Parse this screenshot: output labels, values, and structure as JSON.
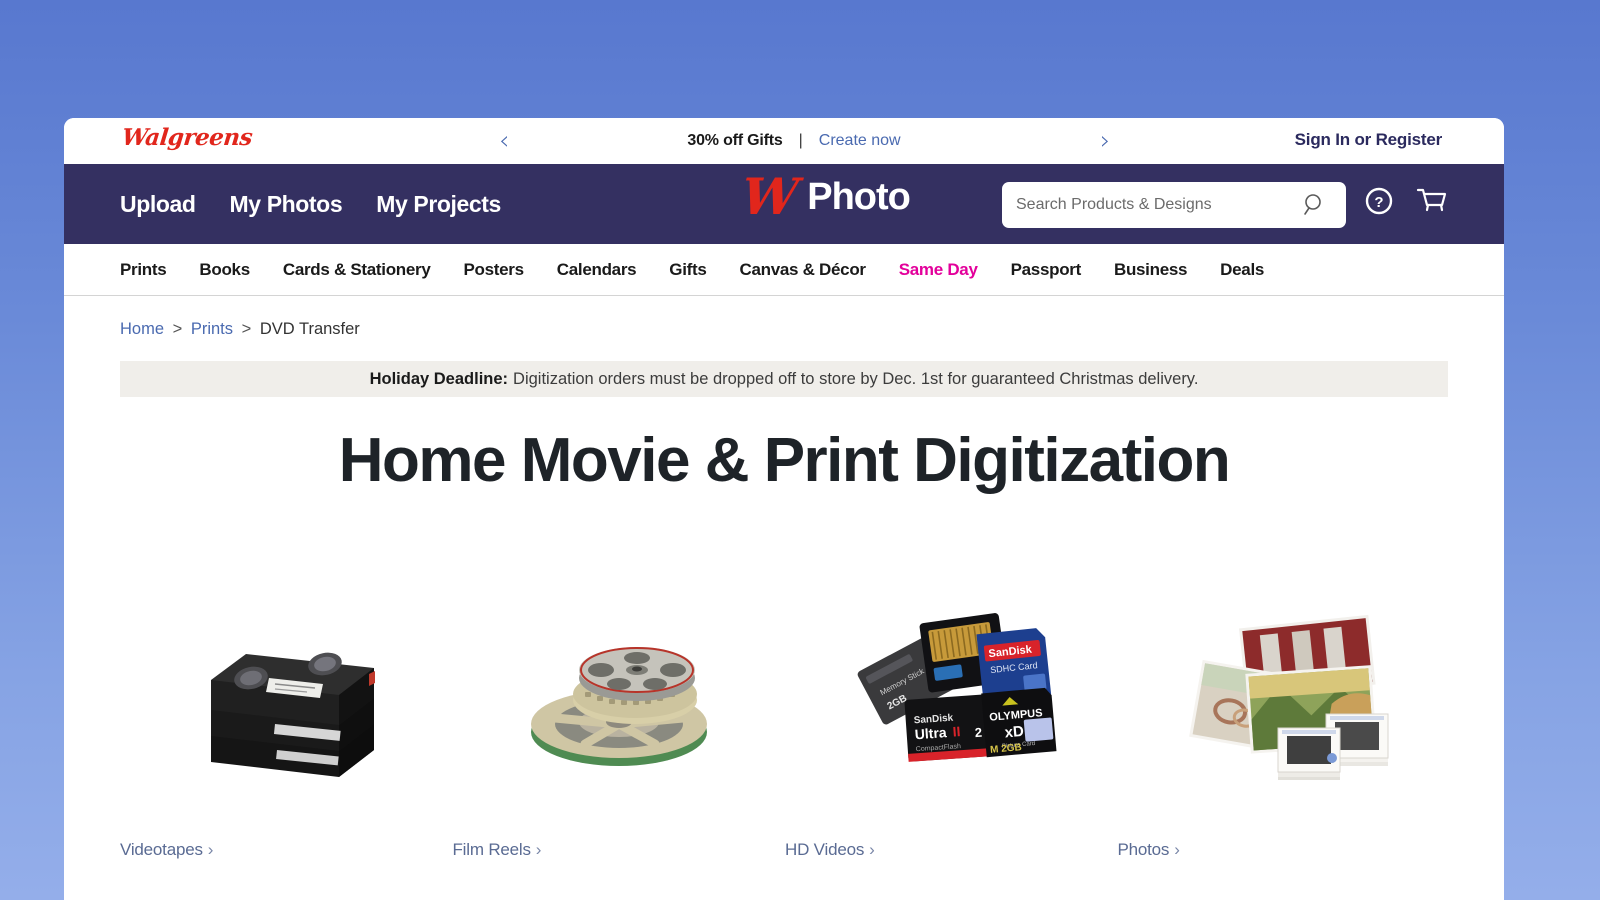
{
  "colors": {
    "navy": "#343061",
    "red": "#e1261c",
    "magenta": "#e3009b",
    "link_blue": "#4a6ab0",
    "slate_link": "#5a6b93",
    "banner_bg": "#f0eeea",
    "page_bg_top": "#5878cf",
    "page_bg_bottom": "#94aeea"
  },
  "promo_bar": {
    "logo_text": "Walgreens",
    "deal_text": "30% off Gifts",
    "separator": "|",
    "link_text": "Create now",
    "prev_arrow": "‹",
    "next_arrow": "›",
    "sign_in": "Sign In or Register"
  },
  "navbar": {
    "links": [
      {
        "label": "Upload"
      },
      {
        "label": "My Photos"
      },
      {
        "label": "My Projects"
      }
    ],
    "brand_mark": "W",
    "brand_text": "Photo",
    "search": {
      "placeholder": "Search Products & Designs",
      "value": ""
    },
    "icons": [
      {
        "name": "help-icon",
        "glyph": "?"
      },
      {
        "name": "cart-icon",
        "glyph": "cart"
      }
    ]
  },
  "category_nav": {
    "items": [
      {
        "label": "Prints",
        "highlight": false
      },
      {
        "label": "Books",
        "highlight": false
      },
      {
        "label": "Cards & Stationery",
        "highlight": false
      },
      {
        "label": "Posters",
        "highlight": false
      },
      {
        "label": "Calendars",
        "highlight": false
      },
      {
        "label": "Gifts",
        "highlight": false
      },
      {
        "label": "Canvas & Décor",
        "highlight": false
      },
      {
        "label": "Same Day",
        "highlight": true
      },
      {
        "label": "Passport",
        "highlight": false
      },
      {
        "label": "Business",
        "highlight": false
      },
      {
        "label": "Deals",
        "highlight": false
      }
    ]
  },
  "breadcrumb": {
    "items": [
      {
        "label": "Home",
        "is_link": true
      },
      {
        "label": "Prints",
        "is_link": true
      },
      {
        "label": "DVD Transfer",
        "is_link": false
      }
    ],
    "separator": ">"
  },
  "holiday_banner": {
    "bold_prefix": "Holiday Deadline:",
    "message": "Digitization orders must be dropped off to store by Dec. 1st for guaranteed Christmas delivery."
  },
  "main": {
    "page_title": "Home Movie & Print Digitization",
    "tiles": [
      {
        "label": "Videotapes",
        "chevron": "›",
        "image": "videotapes-stack"
      },
      {
        "label": "Film Reels",
        "chevron": "›",
        "image": "film-reels"
      },
      {
        "label": "HD Videos",
        "chevron": "›",
        "image": "memory-cards"
      },
      {
        "label": "Photos",
        "chevron": "›",
        "image": "photo-prints-slides"
      }
    ]
  }
}
